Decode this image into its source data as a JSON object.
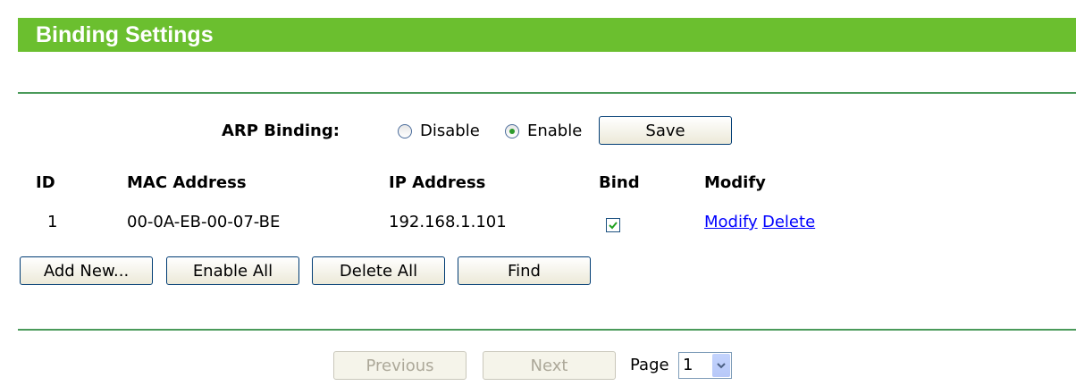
{
  "header": {
    "title": "Binding Settings"
  },
  "arp": {
    "label": "ARP Binding:",
    "options": [
      {
        "label": "Disable",
        "checked": false
      },
      {
        "label": "Enable",
        "checked": true
      }
    ],
    "save_label": "Save"
  },
  "table": {
    "columns": [
      "ID",
      "MAC Address",
      "IP Address",
      "Bind",
      "Modify"
    ],
    "rows": [
      {
        "id": "1",
        "mac": "00-0A-EB-00-07-BE",
        "ip": "192.168.1.101",
        "bind": true,
        "modify_label": "Modify",
        "delete_label": "Delete"
      }
    ]
  },
  "actions": {
    "add_new": "Add New...",
    "enable_all": "Enable All",
    "delete_all": "Delete All",
    "find": "Find"
  },
  "pagination": {
    "previous": "Previous",
    "next": "Next",
    "page_label": "Page",
    "page_value": "1"
  },
  "colors": {
    "header_bg": "#6bbf2f",
    "rule": "#4a9a5a",
    "link": "#0000ff"
  }
}
